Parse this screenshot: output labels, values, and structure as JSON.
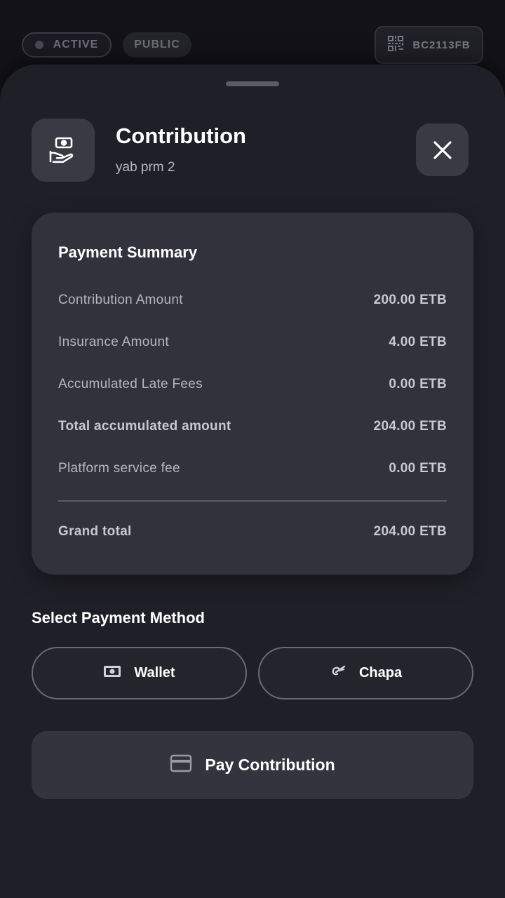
{
  "status_bar": {
    "active_label": "ACTIVE",
    "public_label": "PUBLIC",
    "code": "BC2113FB"
  },
  "header": {
    "title": "Contribution",
    "subtitle": "yab prm 2"
  },
  "summary": {
    "title": "Payment Summary",
    "rows": [
      {
        "label": "Contribution Amount",
        "value": "200.00 ETB"
      },
      {
        "label": "Insurance Amount",
        "value": "4.00 ETB"
      },
      {
        "label": "Accumulated Late Fees",
        "value": "0.00 ETB"
      },
      {
        "label": "Total accumulated amount",
        "value": "204.00 ETB"
      },
      {
        "label": "Platform service fee",
        "value": "0.00 ETB"
      }
    ],
    "grand_total": {
      "label": "Grand total",
      "value": "204.00 ETB"
    }
  },
  "payment_methods": {
    "title": "Select Payment Method",
    "options": [
      {
        "label": "Wallet",
        "icon": "cash-icon"
      },
      {
        "label": "Chapa",
        "icon": "chapa-icon"
      }
    ]
  },
  "pay_button": {
    "label": "Pay Contribution",
    "icon": "card-icon"
  }
}
